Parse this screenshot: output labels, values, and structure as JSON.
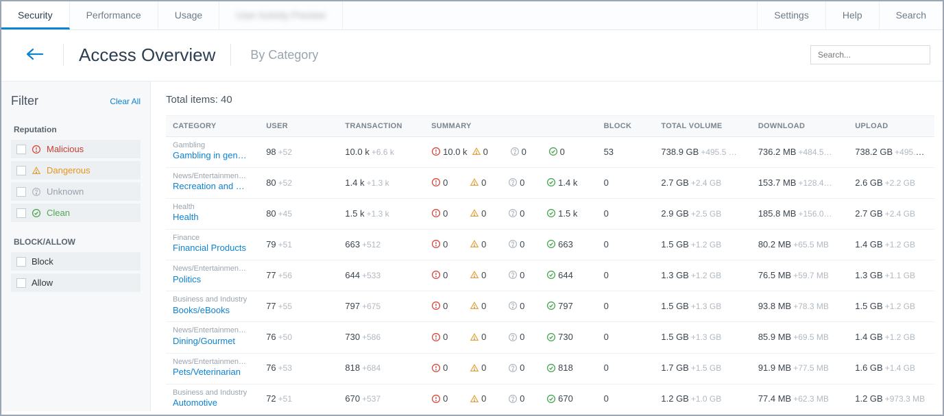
{
  "topbar": {
    "tabs_left": [
      "Security",
      "Performance",
      "Usage"
    ],
    "tab_blurred": "User Activity Preview",
    "tabs_right": [
      "Settings",
      "Help",
      "Search"
    ],
    "active": "Security"
  },
  "header": {
    "title": "Access Overview",
    "subtitle": "By Category",
    "search_placeholder": "Search..."
  },
  "sidebar": {
    "filter_title": "Filter",
    "clear_all": "Clear All",
    "group_reputation": "Reputation",
    "reputation": [
      {
        "label": "Malicious",
        "cls": "txt-malicious",
        "icon": "mal"
      },
      {
        "label": "Dangerous",
        "cls": "txt-dangerous",
        "icon": "dan"
      },
      {
        "label": "Unknown",
        "cls": "txt-unknown",
        "icon": "unk"
      },
      {
        "label": "Clean",
        "cls": "txt-clean",
        "icon": "cln"
      }
    ],
    "group_block": "BLOCK/ALLOW",
    "block": [
      {
        "label": "Block"
      },
      {
        "label": "Allow"
      }
    ]
  },
  "main": {
    "total_label": "Total items: 40",
    "columns": [
      "CATEGORY",
      "USER",
      "TRANSACTION",
      "SUMMARY",
      "BLOCK",
      "TOTAL VOLUME",
      "DOWNLOAD",
      "UPLOAD"
    ],
    "rows": [
      {
        "parent": "Gambling",
        "name": "Gambling in gen…",
        "user_v": "98",
        "user_d": "+52",
        "txn_v": "10.0 k",
        "txn_d": "+6.6 k",
        "s_mal": "10.0 k",
        "s_dan": "0",
        "s_unk": "0",
        "s_cln": "0",
        "block": "53",
        "tv_v": "738.9 GB",
        "tv_d": "+495.5 …",
        "dl_v": "736.2 MB",
        "dl_d": "+484.5…",
        "ul_v": "738.2 GB",
        "ul_d": "+495.0 …"
      },
      {
        "parent": "News/Entertainmen…",
        "name": "Recreation and …",
        "user_v": "80",
        "user_d": "+52",
        "txn_v": "1.4 k",
        "txn_d": "+1.3 k",
        "s_mal": "0",
        "s_dan": "0",
        "s_unk": "0",
        "s_cln": "1.4 k",
        "block": "0",
        "tv_v": "2.7 GB",
        "tv_d": "+2.4 GB",
        "dl_v": "153.7 MB",
        "dl_d": "+128.4…",
        "ul_v": "2.6 GB",
        "ul_d": "+2.2 GB"
      },
      {
        "parent": "Health",
        "name": "Health",
        "user_v": "80",
        "user_d": "+45",
        "txn_v": "1.5 k",
        "txn_d": "+1.3 k",
        "s_mal": "0",
        "s_dan": "0",
        "s_unk": "0",
        "s_cln": "1.5 k",
        "block": "0",
        "tv_v": "2.9 GB",
        "tv_d": "+2.5 GB",
        "dl_v": "185.8 MB",
        "dl_d": "+156.0…",
        "ul_v": "2.7 GB",
        "ul_d": "+2.4 GB"
      },
      {
        "parent": "Finance",
        "name": "Financial Products",
        "user_v": "79",
        "user_d": "+51",
        "txn_v": "663",
        "txn_d": "+512",
        "s_mal": "0",
        "s_dan": "0",
        "s_unk": "0",
        "s_cln": "663",
        "block": "0",
        "tv_v": "1.5 GB",
        "tv_d": "+1.2 GB",
        "dl_v": "80.2 MB",
        "dl_d": "+65.5 MB",
        "ul_v": "1.4 GB",
        "ul_d": "+1.2 GB"
      },
      {
        "parent": "News/Entertainmen…",
        "name": "Politics",
        "user_v": "77",
        "user_d": "+56",
        "txn_v": "644",
        "txn_d": "+533",
        "s_mal": "0",
        "s_dan": "0",
        "s_unk": "0",
        "s_cln": "644",
        "block": "0",
        "tv_v": "1.3 GB",
        "tv_d": "+1.2 GB",
        "dl_v": "76.5 MB",
        "dl_d": "+59.7 MB",
        "ul_v": "1.3 GB",
        "ul_d": "+1.1 GB"
      },
      {
        "parent": "Business and Industry",
        "name": "Books/eBooks",
        "user_v": "77",
        "user_d": "+55",
        "txn_v": "797",
        "txn_d": "+675",
        "s_mal": "0",
        "s_dan": "0",
        "s_unk": "0",
        "s_cln": "797",
        "block": "0",
        "tv_v": "1.5 GB",
        "tv_d": "+1.3 GB",
        "dl_v": "93.8 MB",
        "dl_d": "+78.3 MB",
        "ul_v": "1.5 GB",
        "ul_d": "+1.2 GB"
      },
      {
        "parent": "News/Entertainmen…",
        "name": "Dining/Gourmet",
        "user_v": "76",
        "user_d": "+50",
        "txn_v": "730",
        "txn_d": "+586",
        "s_mal": "0",
        "s_dan": "0",
        "s_unk": "0",
        "s_cln": "730",
        "block": "0",
        "tv_v": "1.5 GB",
        "tv_d": "+1.3 GB",
        "dl_v": "85.9 MB",
        "dl_d": "+69.5 MB",
        "ul_v": "1.4 GB",
        "ul_d": "+1.2 GB"
      },
      {
        "parent": "News/Entertainmen…",
        "name": "Pets/Veterinarian",
        "user_v": "76",
        "user_d": "+53",
        "txn_v": "818",
        "txn_d": "+684",
        "s_mal": "0",
        "s_dan": "0",
        "s_unk": "0",
        "s_cln": "818",
        "block": "0",
        "tv_v": "1.7 GB",
        "tv_d": "+1.5 GB",
        "dl_v": "91.9 MB",
        "dl_d": "+77.5 MB",
        "ul_v": "1.6 GB",
        "ul_d": "+1.4 GB"
      },
      {
        "parent": "Business and Industry",
        "name": "Automotive",
        "user_v": "72",
        "user_d": "+51",
        "txn_v": "670",
        "txn_d": "+537",
        "s_mal": "0",
        "s_dan": "0",
        "s_unk": "0",
        "s_cln": "670",
        "block": "0",
        "tv_v": "1.2 GB",
        "tv_d": "+1.0 GB",
        "dl_v": "77.4 MB",
        "dl_d": "+62.3 MB",
        "ul_v": "1.2 GB",
        "ul_d": "+973.3 MB"
      }
    ]
  }
}
